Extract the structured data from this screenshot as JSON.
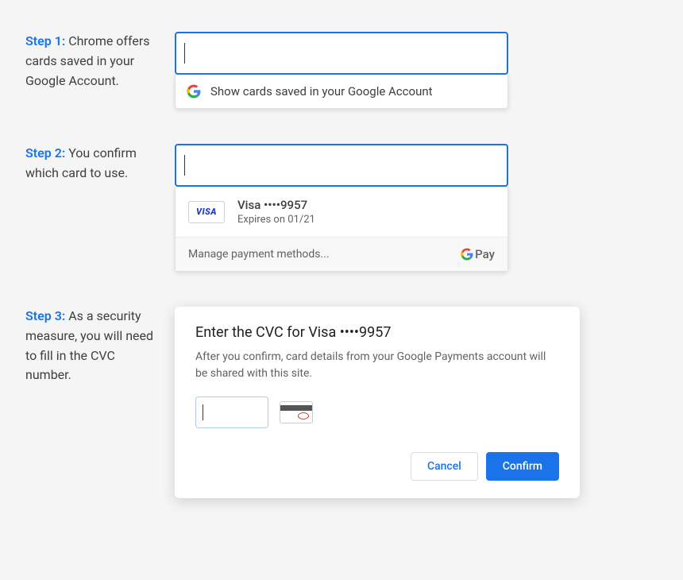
{
  "steps": {
    "step1": {
      "label": "Step 1:",
      "desc": "Chrome offers cards saved in your Google Account.",
      "suggestion": "Show cards saved in your Google Account"
    },
    "step2": {
      "label": "Step 2:",
      "desc": "You confirm which card to use.",
      "card": {
        "brand": "VISA",
        "display": "Visa ••••9957",
        "expiry": "Expires on 01/21"
      },
      "manage": "Manage payment methods...",
      "gpay": "Pay"
    },
    "step3": {
      "label": "Step 3:",
      "desc": "As a security measure, you will need to fill in the CVC number.",
      "dialog": {
        "title": "Enter the CVC for Visa ••••9957",
        "desc": "After you confirm, card details from your Google Payments account will be shared with this site.",
        "cancel": "Cancel",
        "confirm": "Confirm"
      }
    }
  }
}
